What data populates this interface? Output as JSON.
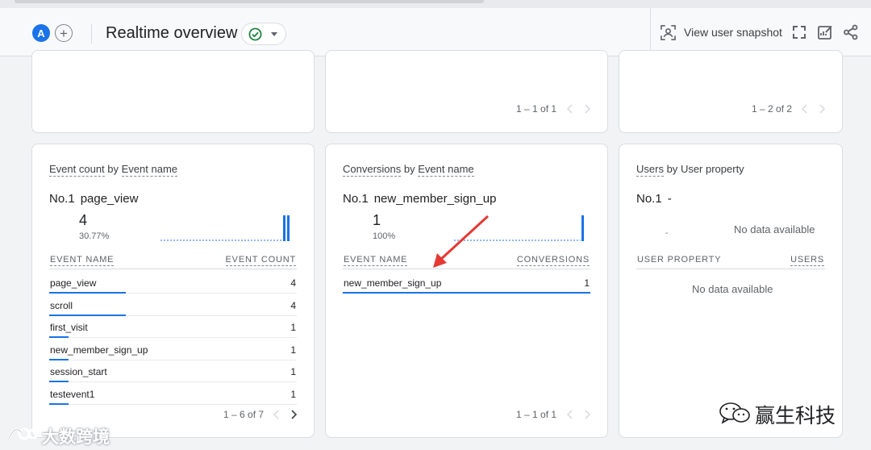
{
  "header": {
    "avatar_letter": "A",
    "add_symbol": "+",
    "title": "Realtime overview",
    "status_icon": "check-circle-icon",
    "snapshot_label": "View user snapshot",
    "icons": [
      "user-snapshot-icon",
      "fullscreen-icon",
      "customize-report-icon",
      "share-icon"
    ],
    "accent_color": "#1a73e8",
    "ok_color": "#188038"
  },
  "top_cards": [
    {
      "pager": ""
    },
    {
      "pager": "1 – 1 of 1"
    },
    {
      "pager": "1 – 2 of 2"
    }
  ],
  "event_card": {
    "title_part1": "Event count",
    "title_by": "by",
    "title_part2": "Event name",
    "top_rank": "No.1",
    "top_name": "page_view",
    "top_value": "4",
    "top_percent": "30.77%",
    "col_name": "EVENT NAME",
    "col_value": "EVENT COUNT",
    "rows": [
      {
        "name": "page_view",
        "value": "4",
        "share": 1.0
      },
      {
        "name": "scroll",
        "value": "4",
        "share": 1.0
      },
      {
        "name": "first_visit",
        "value": "1",
        "share": 0.25
      },
      {
        "name": "new_member_sign_up",
        "value": "1",
        "share": 0.25
      },
      {
        "name": "session_start",
        "value": "1",
        "share": 0.25
      },
      {
        "name": "testevent1",
        "value": "1",
        "share": 0.25
      }
    ],
    "pager": "1 – 6 of 7"
  },
  "conv_card": {
    "title_part1": "Conversions",
    "title_by": "by",
    "title_part2": "Event name",
    "top_rank": "No.1",
    "top_name": "new_member_sign_up",
    "top_value": "1",
    "top_percent": "100%",
    "col_name": "EVENT NAME",
    "col_value": "CONVERSIONS",
    "rows": [
      {
        "name": "new_member_sign_up",
        "value": "1",
        "share": 1.0
      }
    ],
    "pager": "1 – 1 of 1",
    "annotation_arrow_color": "#e53935"
  },
  "users_card": {
    "title_part1": "Users",
    "title_by": "by",
    "title_part2": "User property",
    "top_rank": "No.1",
    "top_name": "-",
    "chart_placeholder": "-",
    "chart_nodata": "No data available",
    "col_name": "USER PROPERTY",
    "col_value": "USERS",
    "table_nodata": "No data available"
  },
  "watermarks": {
    "left": "大数跨境",
    "right": "赢生科技"
  }
}
